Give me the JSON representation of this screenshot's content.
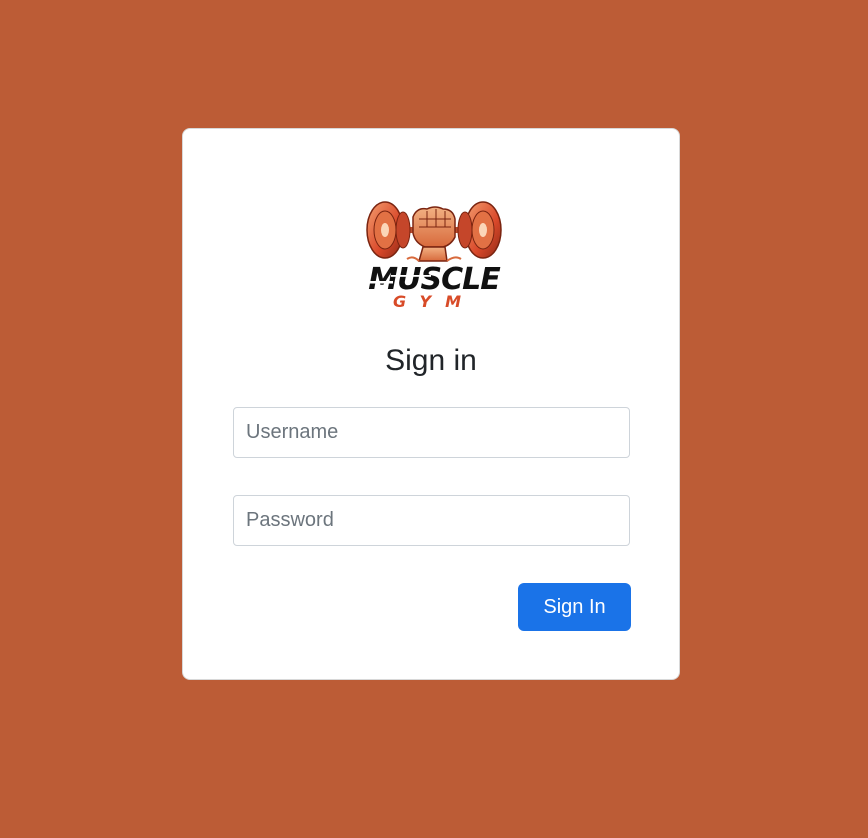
{
  "logo": {
    "line1": "MUSCLE",
    "line2": "GYM",
    "icon": "dumbbell-fist-icon"
  },
  "login": {
    "title": "Sign in",
    "username_placeholder": "Username",
    "username_value": "",
    "password_placeholder": "Password",
    "password_value": "",
    "submit_label": "Sign In"
  },
  "colors": {
    "background": "#bc5c36",
    "card": "#ffffff",
    "button": "#1a73e8",
    "logo_orange": "#e8622b",
    "logo_dark_red": "#a8361f"
  }
}
